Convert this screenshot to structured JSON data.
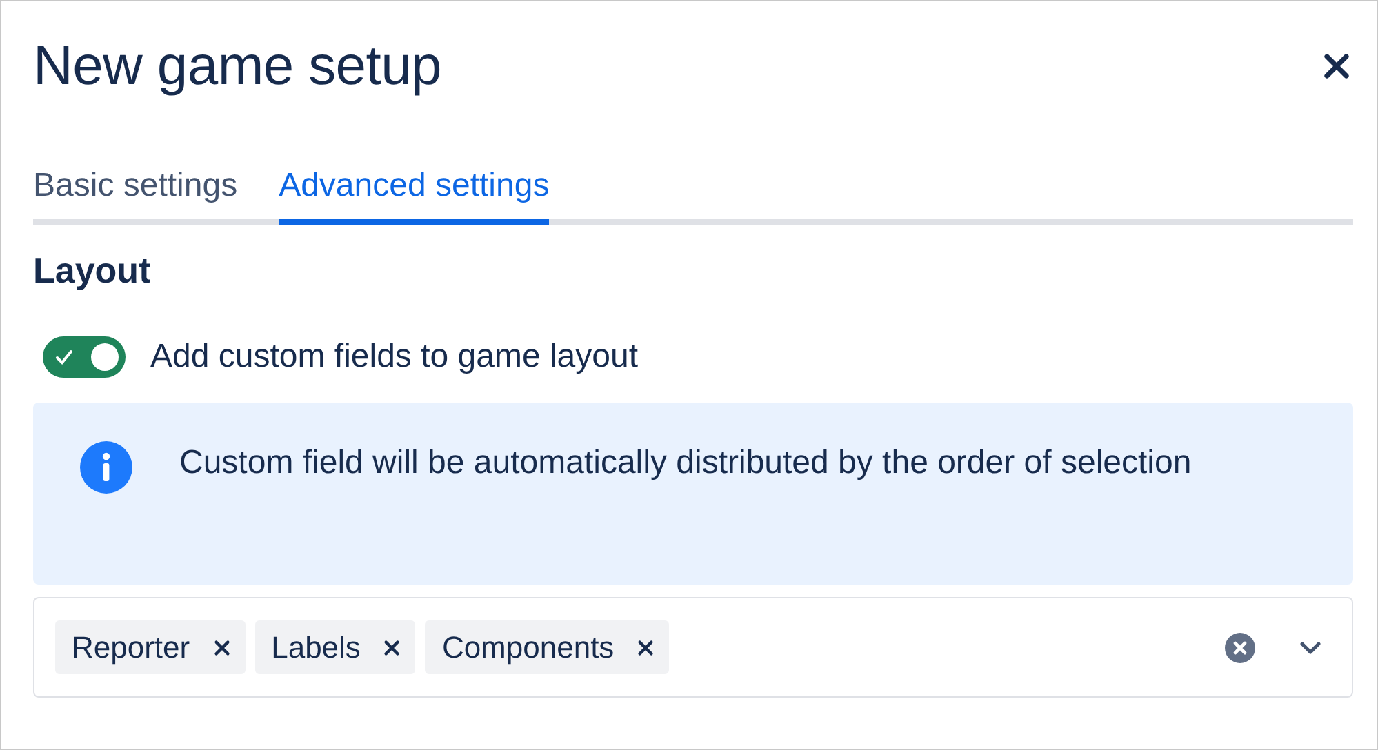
{
  "dialog": {
    "title": "New game setup"
  },
  "tabs": [
    {
      "label": "Basic settings",
      "selected": false
    },
    {
      "label": "Advanced settings",
      "selected": true
    }
  ],
  "section": {
    "heading": "Layout"
  },
  "toggle": {
    "label": "Add custom fields to game layout",
    "on": true
  },
  "info": {
    "message": "Custom field will be automatically distributed by the order of selection"
  },
  "select": {
    "tags": [
      "Reporter",
      "Labels",
      "Components"
    ]
  }
}
